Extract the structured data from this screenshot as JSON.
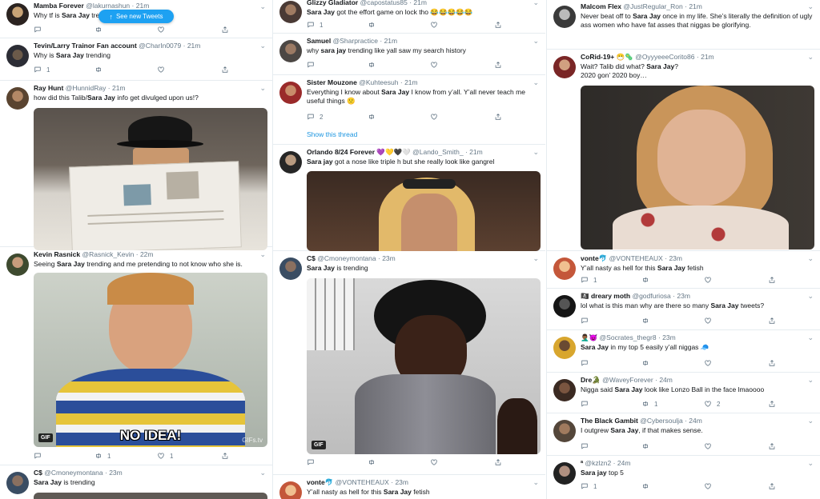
{
  "new_tweets_pill": {
    "label": "See new Tweets",
    "icon": "arrow-up-icon"
  },
  "columns": [
    {
      "tweets": [
        {
          "name": "Mamba Forever",
          "handle": "@lakurnashun",
          "time": "21m",
          "text_html": "Why tf is <b>Sara Jay</b> trending",
          "reply": "",
          "retweet": "",
          "like": ""
        },
        {
          "name": "Tevin/Larry Trainor Fan account",
          "handle": "@CharIn0079",
          "time": "21m",
          "text_html": "Why is <b>Sara Jay</b> trending",
          "reply": "1",
          "retweet": "",
          "like": ""
        },
        {
          "name": "Ray Hunt",
          "handle": "@HunnidRay",
          "time": "21m",
          "text_html": "how did this Talib/<b>Sara Jay</b> info get divulged upon us!?",
          "reply": "",
          "retweet": "",
          "like": ""
        },
        {
          "name": "Kevin Rasnick",
          "handle": "@Rasnick_Kevin",
          "time": "22m",
          "text_html": "Seeing <b>Sara Jay</b> trending and me pretending to not know who she is.",
          "reply": "",
          "retweet": "1",
          "like": "1",
          "gif_badge": "GIF",
          "caption": "NO IDEA!",
          "watermark": "GIFs.tv"
        },
        {
          "name": "C$",
          "handle": "@Cmoneymontana",
          "time": "23m",
          "text_html": "<b>Sara Jay</b> is trending",
          "reply": "",
          "retweet": "",
          "like": ""
        }
      ]
    },
    {
      "tweets": [
        {
          "name": "Glizzy Gladiator",
          "handle": "@capostatus85",
          "time": "21m",
          "text_html": "<b>Sara Jay</b> got the effort game on lock tho 😂😂😂😂😂",
          "reply": "1",
          "retweet": "",
          "like": ""
        },
        {
          "name": "Samuel",
          "handle": "@Sharpractice",
          "time": "21m",
          "text_html": "why <b>sara jay</b> trending like yall saw my search history",
          "reply": "",
          "retweet": "",
          "like": ""
        },
        {
          "name": "Sister Mouzone",
          "handle": "@Kuhteesuh",
          "time": "21m",
          "text_html": "Everything I know about <b>Sara Jay</b> I know from y’all. Y’all never teach me useful things 🙁",
          "reply": "2",
          "retweet": "",
          "like": "",
          "show_thread": "Show this thread"
        },
        {
          "name": "Orlando 8/24 Forever 💜💛🖤🤍",
          "handle": "@Lando_Smith_",
          "time": "21m",
          "text_html": "<b>Sara jay</b> got a nose like triple h but she really look like gangrel",
          "reply": "",
          "retweet": "",
          "like": ""
        },
        {
          "name": "C$",
          "handle": "@Cmoneymontana",
          "time": "23m",
          "text_html": "<b>Sara Jay</b> is trending",
          "reply": "",
          "retweet": "",
          "like": "",
          "gif_badge": "GIF"
        },
        {
          "name": "vonte🐬",
          "handle": "@VONTEHEAUX",
          "time": "23m",
          "text_html": "Y’all nasty as hell for this <b>Sara Jay</b> fetish",
          "reply": "",
          "retweet": "",
          "like": ""
        }
      ]
    },
    {
      "tweets": [
        {
          "name": "Malcom Flex",
          "handle": "@JustRegular_Ron",
          "time": "21m",
          "text_html": "Never beat off to <b>Sara Jay</b> once in my life. She’s literally the definition of ugly ass women who have fat asses that niggas be glorifying.",
          "reply": "",
          "retweet": "",
          "like": ""
        },
        {
          "name": "CoRid-19+ 😷🦠",
          "handle": "@OyyyeeeCorito86",
          "time": "21m",
          "text_html": "Wait? Talib did what? <b>Sara Jay</b>?<br>2020 gon’ 2020 boy…",
          "reply": "",
          "retweet": "",
          "like": ""
        },
        {
          "name": "vonte🐬",
          "handle": "@VONTEHEAUX",
          "time": "23m",
          "text_html": "Y’all nasty as hell for this <b>Sara Jay</b> fetish",
          "reply": "1",
          "retweet": "",
          "like": ""
        },
        {
          "name": "🏴‍☠️ dreary moth",
          "handle": "@godfuriosa",
          "time": "23m",
          "text_html": "lol what is this man why are there so many <b>Sara Jay</b> tweets?",
          "reply": "",
          "retweet": "",
          "like": ""
        },
        {
          "name": "🤦🏾‍♂️😈",
          "handle": "@Socrates_thegr8",
          "time": "23m",
          "text_html": "<b>Sara Jay</b> in my top 5 easily y’all niggas 🧢",
          "reply": "",
          "retweet": "",
          "like": ""
        },
        {
          "name": "Dre🐊",
          "handle": "@WaveyForever",
          "time": "24m",
          "text_html": "Nigga said <b>Sara Jay</b> look like Lonzo Ball in the face lmaoooo",
          "reply": "",
          "retweet": "1",
          "like": "2"
        },
        {
          "name": "The Black Gambit",
          "handle": "@Cybersoulja",
          "time": "24m",
          "text_html": "I outgrew <b>Sara Jay</b>, if that makes sense.",
          "reply": "",
          "retweet": "",
          "like": ""
        },
        {
          "name": "ª",
          "handle": "@kzlzn2",
          "time": "24m",
          "text_html": "<b>Sara jay</b> top 5",
          "reply": "1",
          "retweet": "",
          "like": ""
        }
      ]
    }
  ],
  "icons": {
    "reply": "reply-icon",
    "retweet": "retweet-icon",
    "like": "heart-icon",
    "share": "share-icon",
    "more": "chevron-down-icon"
  },
  "colors": {
    "accent": "#1da1f2",
    "text": "#14171a",
    "muted": "#657786",
    "border": "#e6ecf0"
  }
}
